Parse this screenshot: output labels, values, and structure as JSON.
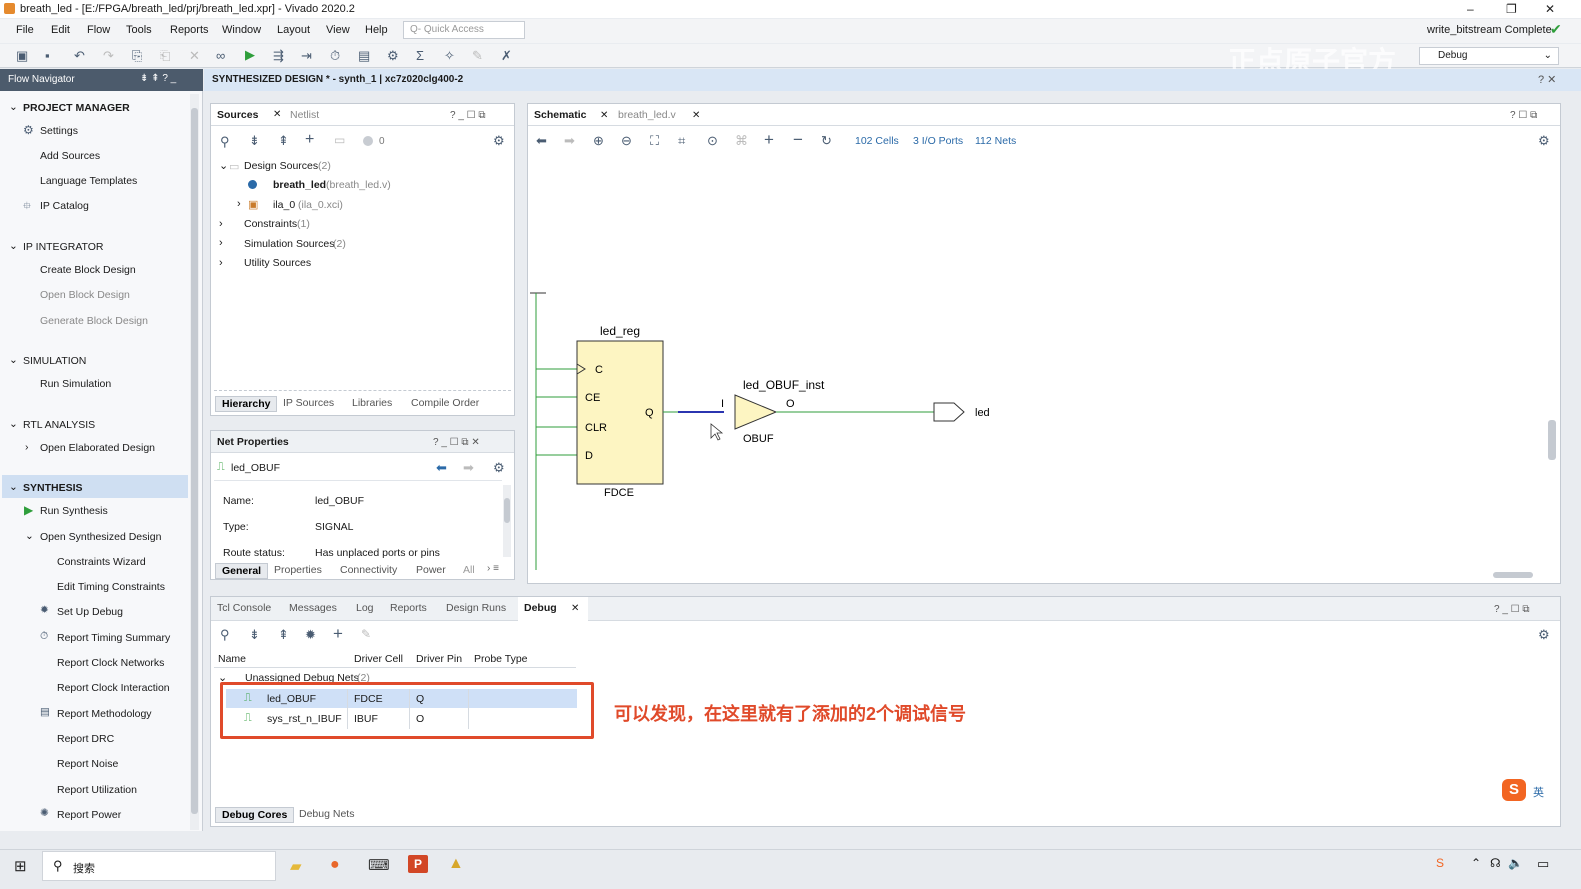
{
  "window": {
    "title": "breath_led - [E:/FPGA/breath_led/prj/breath_led.xpr] - Vivado 2020.2",
    "status": "write_bitstream Complete",
    "layout": "Debug"
  },
  "menu": [
    "File",
    "Edit",
    "Flow",
    "Tools",
    "Reports",
    "Window",
    "Layout",
    "View",
    "Help"
  ],
  "quick_access": "Q- Quick Access",
  "watermark": "正点原子官方",
  "nav": {
    "title": "Flow Navigator",
    "project_manager": "PROJECT MANAGER",
    "settings": "Settings",
    "add_sources": "Add Sources",
    "lang_templates": "Language Templates",
    "ip_catalog": "IP Catalog",
    "ip_integrator": "IP INTEGRATOR",
    "create_bd": "Create Block Design",
    "open_bd": "Open Block Design",
    "gen_bd": "Generate Block Design",
    "simulation": "SIMULATION",
    "run_sim": "Run Simulation",
    "rtl": "RTL ANALYSIS",
    "open_elab": "Open Elaborated Design",
    "synthesis": "SYNTHESIS",
    "run_synth": "Run Synthesis",
    "open_synth": "Open Synthesized Design",
    "constraints_wizard": "Constraints Wizard",
    "edit_timing": "Edit Timing Constraints",
    "setup_debug": "Set Up Debug",
    "timing_summary": "Report Timing Summary",
    "clock_networks": "Report Clock Networks",
    "clock_interaction": "Report Clock Interaction",
    "methodology": "Report Methodology",
    "drc": "Report DRC",
    "noise": "Report Noise",
    "utilization": "Report Utilization",
    "power": "Report Power"
  },
  "synth_bar": "SYNTHESIZED DESIGN * - synth_1 | xc7z020clg400-2",
  "sources": {
    "tab_sources": "Sources",
    "tab_netlist": "Netlist",
    "count": "0",
    "design_sources": "Design Sources",
    "design_count": "(2)",
    "top": "breath_led",
    "top_file": "(breath_led.v)",
    "ila": "ila_0",
    "ila_file": "(ila_0.xci)",
    "constraints": "Constraints",
    "constraints_count": "(1)",
    "sim_sources": "Simulation Sources",
    "sim_count": "(2)",
    "utility": "Utility Sources",
    "bottom_tabs": [
      "Hierarchy",
      "IP Sources",
      "Libraries",
      "Compile Order"
    ]
  },
  "net_props": {
    "title": "Net Properties",
    "net": "led_OBUF",
    "name_label": "Name:",
    "name_value": "led_OBUF",
    "type_label": "Type:",
    "type_value": "SIGNAL",
    "route_label": "Route status:",
    "route_value": "Has unplaced ports or pins",
    "tabs": [
      "General",
      "Properties",
      "Connectivity",
      "Power",
      "All"
    ]
  },
  "schematic": {
    "tab": "Schematic",
    "file_tab": "breath_led.v",
    "cells": "102 Cells",
    "ports": "3 I/O Ports",
    "nets": "112 Nets",
    "reg_name": "led_reg",
    "reg_type": "FDCE",
    "pin_c": "C",
    "pin_ce": "CE",
    "pin_clr": "CLR",
    "pin_d": "D",
    "pin_q": "Q",
    "buf_name": "led_OBUF_inst",
    "buf_type": "OBUF",
    "pin_i": "I",
    "pin_o": "O",
    "port": "led"
  },
  "console": {
    "tabs": [
      "Tcl Console",
      "Messages",
      "Log",
      "Reports",
      "Design Runs",
      "Debug"
    ],
    "columns": [
      "Name",
      "Driver Cell",
      "Driver Pin",
      "Probe Type"
    ],
    "group": "Unassigned Debug Nets",
    "group_count": "(2)",
    "rows": [
      {
        "name": "led_OBUF",
        "cell": "FDCE",
        "pin": "Q"
      },
      {
        "name": "sys_rst_n_IBUF",
        "cell": "IBUF",
        "pin": "O"
      }
    ],
    "bottom_tabs": [
      "Debug Cores",
      "Debug Nets"
    ]
  },
  "annotation": "可以发现，在这里就有了添加的2个调试信号",
  "ime": "英",
  "taskbar": {
    "search": "搜索"
  }
}
